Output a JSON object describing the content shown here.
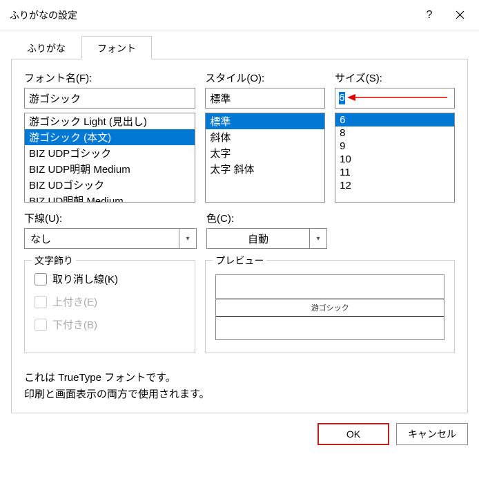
{
  "title": "ふりがなの設定",
  "tabs": {
    "furigana": "ふりがな",
    "font": "フォント"
  },
  "font": {
    "label": "フォント名(F):",
    "value": "游ゴシック",
    "items": [
      "游ゴシック Light (見出し)",
      "游ゴシック (本文)",
      "BIZ UDPゴシック",
      "BIZ UDP明朝 Medium",
      "BIZ UDゴシック",
      "BIZ UD明朝 Medium"
    ]
  },
  "style": {
    "label": "スタイル(O):",
    "value": "標準",
    "items": [
      "標準",
      "斜体",
      "太字",
      "太字 斜体"
    ]
  },
  "size": {
    "label": "サイズ(S):",
    "value": "6",
    "items": [
      "6",
      "8",
      "9",
      "10",
      "11",
      "12"
    ]
  },
  "underline": {
    "label": "下線(U):",
    "value": "なし"
  },
  "color": {
    "label": "色(C):",
    "value": "自動"
  },
  "decoration": {
    "title": "文字飾り",
    "strike": "取り消し線(K)",
    "superscript": "上付き(E)",
    "subscript": "下付き(B)"
  },
  "preview": {
    "title": "プレビュー",
    "text": "游ゴシック"
  },
  "note": {
    "line1": "これは TrueType フォントです。",
    "line2": "印刷と画面表示の両方で使用されます。"
  },
  "buttons": {
    "ok": "OK",
    "cancel": "キャンセル"
  }
}
